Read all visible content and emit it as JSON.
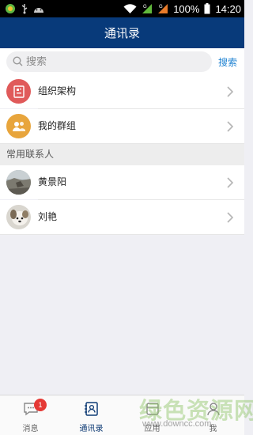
{
  "status_bar": {
    "battery": "100%",
    "time": "14:20",
    "icons": [
      "app-notification-icon",
      "usb-icon",
      "android-icon",
      "wifi-icon",
      "signal-g-icon",
      "signal-g-icon",
      "battery-icon"
    ]
  },
  "header": {
    "title": "通讯录"
  },
  "search": {
    "placeholder": "搜索",
    "button_label": "搜索"
  },
  "menu": [
    {
      "label": "组织架构",
      "icon": "org-chart-icon",
      "color": "#e05a5a"
    },
    {
      "label": "我的群组",
      "icon": "group-icon",
      "color": "#e8a53c"
    }
  ],
  "section": {
    "title": "常用联系人"
  },
  "contacts": [
    {
      "name": "黄景阳",
      "avatar": "photo-avatar"
    },
    {
      "name": "刘艳",
      "avatar": "dog-photo-avatar"
    }
  ],
  "tabs": [
    {
      "label": "消息",
      "icon": "message-icon",
      "badge": "1"
    },
    {
      "label": "通讯录",
      "icon": "contacts-icon",
      "active": true
    },
    {
      "label": "应用",
      "icon": "apps-icon"
    },
    {
      "label": "我",
      "icon": "profile-icon"
    }
  ],
  "colors": {
    "header": "#083a7a",
    "accent": "#1e82d2",
    "badge": "#e53935"
  },
  "watermark": {
    "text": "绿色资源网",
    "url": "www.downcc.com"
  }
}
